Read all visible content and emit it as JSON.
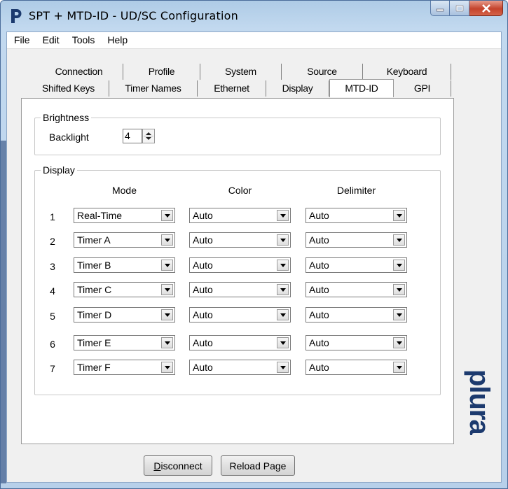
{
  "window": {
    "title": "SPT + MTD-ID - UD/SC Configuration",
    "app_icon": "plura-p-icon",
    "controls": [
      "minimize-icon",
      "maximize-icon",
      "close-icon"
    ]
  },
  "menu": [
    {
      "label": "File"
    },
    {
      "label": "Edit"
    },
    {
      "label": "Tools"
    },
    {
      "label": "Help"
    }
  ],
  "tabs": {
    "back_row": [
      "Connection",
      "Profile",
      "System",
      "Source",
      "Keyboard"
    ],
    "front_row": [
      "Shifted Keys",
      "Timer Names",
      "Ethernet",
      "Display",
      "MTD-ID",
      "GPI"
    ],
    "active": "MTD-ID"
  },
  "brightness": {
    "title": "Brightness",
    "backlight_label": "Backlight",
    "backlight_value": "4"
  },
  "display": {
    "title": "Display",
    "columns": [
      "Mode",
      "Color",
      "Delimiter"
    ],
    "rows": [
      {
        "num": "1",
        "mode": "Real-Time",
        "color": "Auto",
        "delimiter": "Auto"
      },
      {
        "num": "2",
        "mode": "Timer A",
        "color": "Auto",
        "delimiter": "Auto"
      },
      {
        "num": "3",
        "mode": "Timer B",
        "color": "Auto",
        "delimiter": "Auto"
      },
      {
        "num": "4",
        "mode": "Timer C",
        "color": "Auto",
        "delimiter": "Auto"
      },
      {
        "num": "5",
        "mode": "Timer D",
        "color": "Auto",
        "delimiter": "Auto"
      },
      {
        "num": "6",
        "mode": "Timer E",
        "color": "Auto",
        "delimiter": "Auto"
      },
      {
        "num": "7",
        "mode": "Timer F",
        "color": "Auto",
        "delimiter": "Auto"
      }
    ]
  },
  "buttons": {
    "disconnect_first": "D",
    "disconnect_rest": "isconnect",
    "reload": "Reload Page"
  },
  "brand": {
    "text": "plura",
    "color": "#1c3a6e"
  }
}
